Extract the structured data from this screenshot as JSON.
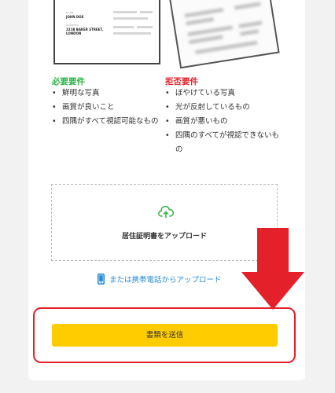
{
  "sample_doc": {
    "name_label": "NAME",
    "name_value": "JOHN DOE",
    "address_label": "ADDRESS",
    "address_value": "221B BAKER STREET, LONDON"
  },
  "requirements": {
    "accepted": {
      "title": "必要要件",
      "color": "#2fb34a",
      "items": [
        "鮮明な写真",
        "画質が良いこと",
        "四隅がすべて視認可能なもの"
      ]
    },
    "rejected": {
      "title": "拒否要件",
      "color": "#e4212b",
      "items": [
        "ぼやけている写真",
        "光が反射しているもの",
        "画質が悪いもの",
        "四隅のすべてが視認できないもの"
      ]
    }
  },
  "upload": {
    "icon": "cloud-upload-icon",
    "label": "居住証明書をアップロード",
    "accent": "#2fb34a"
  },
  "phone_upload": {
    "icon": "mobile-phone-icon",
    "label": "または携帯電話からアップロード",
    "color": "#2a8bd6"
  },
  "submit": {
    "label": "書類を送信",
    "color": "#ffcc00"
  },
  "annotation": {
    "color": "#e4212b"
  }
}
